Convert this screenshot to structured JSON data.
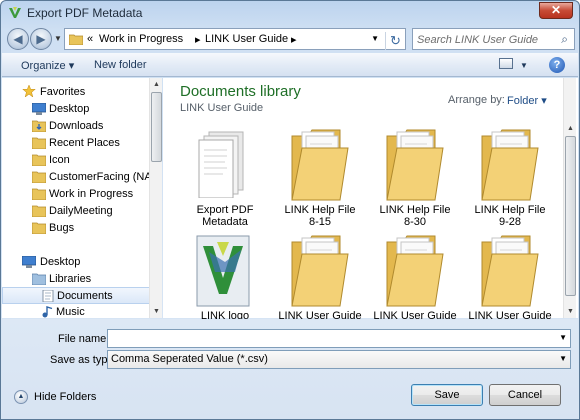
{
  "window": {
    "title": "Export PDF Metadata",
    "close_glyph": "✕"
  },
  "address": {
    "sep": "«",
    "segments": [
      "Work in Progress",
      "LINK User Guide"
    ],
    "chevron": "▸"
  },
  "search": {
    "placeholder": "Search LINK User Guide"
  },
  "toolbar": {
    "organize_label": "Organize ▾",
    "new_folder_label": "New folder",
    "help_glyph": "?"
  },
  "nav": {
    "favorites_label": "Favorites",
    "favorites": [
      "Desktop",
      "Downloads",
      "Recent Places",
      "Icon",
      "CustomerFacing (NAS)",
      "Work in Progress",
      "DailyMeeting",
      "Bugs"
    ],
    "desktop_label": "Desktop",
    "libraries_label": "Libraries",
    "libraries": [
      "Documents",
      "Music"
    ]
  },
  "content": {
    "title": "Documents library",
    "subtitle": "LINK User Guide",
    "arrange_label": "Arrange by:",
    "arrange_value": "Folder ▾",
    "items": [
      {
        "line1": "Export PDF",
        "line2": "Metadata"
      },
      {
        "line1": "LINK Help File",
        "line2": "8-15"
      },
      {
        "line1": "LINK Help File",
        "line2": "8-30"
      },
      {
        "line1": "LINK Help File",
        "line2": "9-28"
      },
      {
        "line1": "LINK logo",
        "line2": ""
      },
      {
        "line1": "LINK User Guide",
        "line2": ""
      },
      {
        "line1": "LINK User Guide",
        "line2": ""
      },
      {
        "line1": "LINK User Guide",
        "line2": ""
      }
    ]
  },
  "form": {
    "filename_label": "File name:",
    "filename_value": "",
    "savetype_label": "Save as type:",
    "savetype_value": "Comma Seperated Value (*.csv)"
  },
  "footer": {
    "hide_folders_label": "Hide Folders",
    "save_label": "Save",
    "cancel_label": "Cancel"
  },
  "icons": {
    "app": "app-icon",
    "back": "back-arrow-icon",
    "forward": "forward-arrow-icon",
    "refresh": "refresh-icon",
    "search": "search-icon",
    "folder": "folder-icon",
    "star": "star-icon",
    "desktop": "desktop-icon",
    "library": "library-icon",
    "music": "music-icon",
    "help": "help-icon"
  },
  "colors": {
    "library_title": "#1f6f27",
    "accent": "#1e4c86"
  }
}
